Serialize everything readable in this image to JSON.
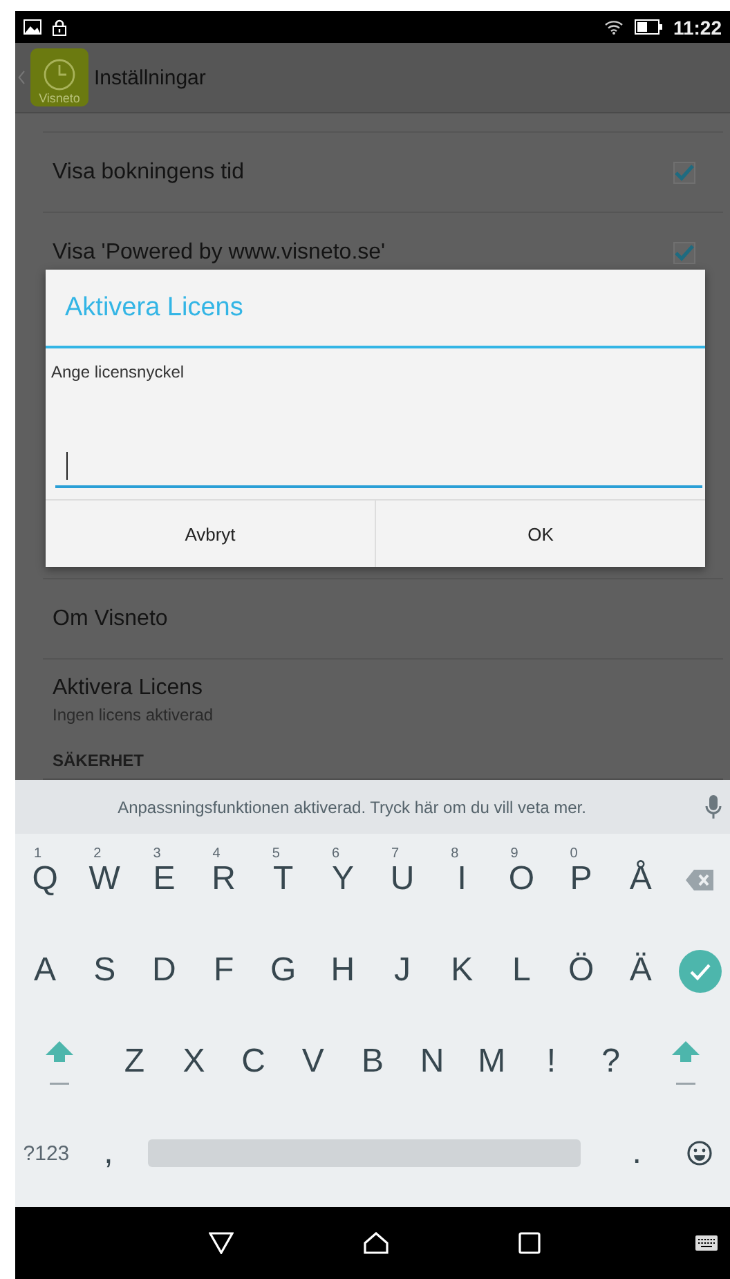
{
  "status_bar": {
    "time": "11:22"
  },
  "app_bar": {
    "logo_text": "Visneto",
    "title": "Inställningar"
  },
  "settings_above": [
    {
      "label": "Visa bokningens tid",
      "kind": "checkbox",
      "checked": true
    },
    {
      "label": "Visa 'Powered by www.visneto.se'",
      "kind": "checkbox",
      "checked": true
    }
  ],
  "settings_below": [
    {
      "label": "Om Visneto",
      "kind": "plain"
    },
    {
      "label": "Aktivera Licens",
      "subtitle": "Ingen licens aktiverad",
      "kind": "plain"
    },
    {
      "label": "SÄKERHET",
      "kind": "header"
    }
  ],
  "dialog": {
    "title": "Aktivera Licens",
    "message": "Ange licensnyckel",
    "field": {
      "focused": true
    },
    "buttons": [
      {
        "label": "Avbryt"
      },
      {
        "label": "OK"
      }
    ]
  },
  "keyboard": {
    "suggestion": "Anpassningsfunktionen aktiverad. Tryck här om du vill veta mer.",
    "rows": [
      {
        "keys": [
          {
            "kind": "letter",
            "label": "Q",
            "hint": "1"
          },
          {
            "kind": "letter",
            "label": "W",
            "hint": "2"
          },
          {
            "kind": "letter",
            "label": "E",
            "hint": "3"
          },
          {
            "kind": "letter",
            "label": "R",
            "hint": "4"
          },
          {
            "kind": "letter",
            "label": "T",
            "hint": "5"
          },
          {
            "kind": "letter",
            "label": "Y",
            "hint": "6"
          },
          {
            "kind": "letter",
            "label": "U",
            "hint": "7"
          },
          {
            "kind": "letter",
            "label": "I",
            "hint": "8"
          },
          {
            "kind": "letter",
            "label": "O",
            "hint": "9"
          },
          {
            "kind": "letter",
            "label": "P",
            "hint": "0"
          },
          {
            "kind": "letter",
            "label": "Å"
          },
          {
            "kind": "backspace"
          }
        ]
      },
      {
        "keys": [
          {
            "kind": "letter",
            "label": "A"
          },
          {
            "kind": "letter",
            "label": "S"
          },
          {
            "kind": "letter",
            "label": "D"
          },
          {
            "kind": "letter",
            "label": "F"
          },
          {
            "kind": "letter",
            "label": "G"
          },
          {
            "kind": "letter",
            "label": "H"
          },
          {
            "kind": "letter",
            "label": "J"
          },
          {
            "kind": "letter",
            "label": "K"
          },
          {
            "kind": "letter",
            "label": "L"
          },
          {
            "kind": "letter",
            "label": "Ö"
          },
          {
            "kind": "letter",
            "label": "Ä"
          },
          {
            "kind": "enter"
          }
        ]
      },
      {
        "keys": [
          {
            "kind": "shift"
          },
          {
            "kind": "letter",
            "label": "Z"
          },
          {
            "kind": "letter",
            "label": "X"
          },
          {
            "kind": "letter",
            "label": "C"
          },
          {
            "kind": "letter",
            "label": "V"
          },
          {
            "kind": "letter",
            "label": "B"
          },
          {
            "kind": "letter",
            "label": "N"
          },
          {
            "kind": "letter",
            "label": "M"
          },
          {
            "kind": "letter",
            "label": "!"
          },
          {
            "kind": "letter",
            "label": "?"
          },
          {
            "kind": "shift"
          }
        ]
      },
      {
        "keys": [
          {
            "kind": "symbols",
            "label": "?123"
          },
          {
            "kind": "punct",
            "label": ","
          },
          {
            "kind": "space"
          },
          {
            "kind": "punct",
            "label": "."
          },
          {
            "kind": "emoji"
          }
        ]
      }
    ]
  }
}
